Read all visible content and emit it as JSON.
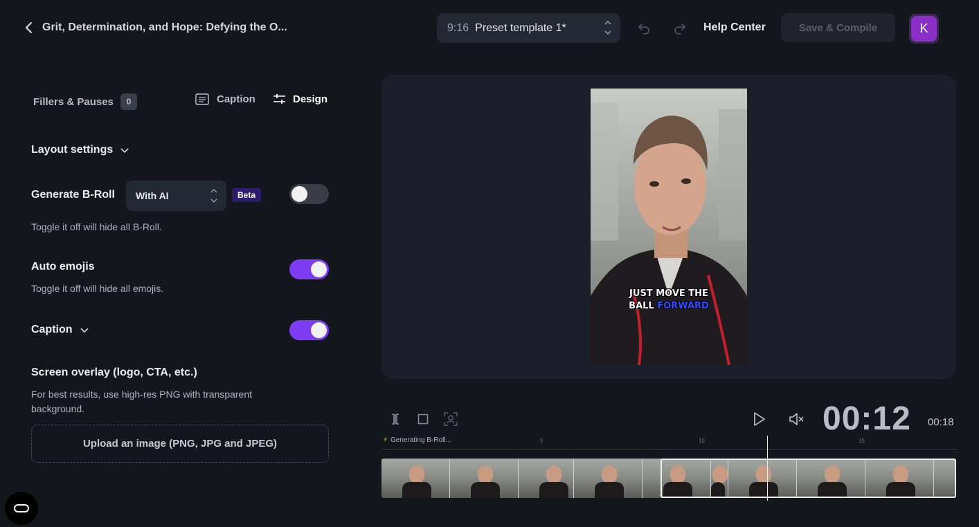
{
  "header": {
    "project_title": "Grit, Determination, and Hope: Defying the O...",
    "preset_ratio": "9:16",
    "preset_name": "Preset template 1*",
    "help_label": "Help Center",
    "save_label": "Save & Compile",
    "avatar_initial": "K"
  },
  "tabs": {
    "fillers_label": "Fillers & Pauses",
    "fillers_count": "0",
    "caption_label": "Caption",
    "design_label": "Design"
  },
  "settings": {
    "layout_label": "Layout settings",
    "broll_label": "Generate B-Roll",
    "broll_mode": "With AI",
    "beta_label": "Beta",
    "broll_desc": "Toggle it off will hide all B-Roll.",
    "broll_enabled": false,
    "emojis_label": "Auto emojis",
    "emojis_desc": "Toggle it off will hide all emojis.",
    "emojis_enabled": true,
    "caption_label": "Caption",
    "caption_enabled": true,
    "overlay_label": "Screen overlay (logo, CTA, etc.)",
    "overlay_desc": "For best results, use high-res PNG with transparent background.",
    "upload_label": "Upload an image (PNG, JPG and JPEG)"
  },
  "preview": {
    "caption_line1": "JUST MOVE THE",
    "caption_line2_plain": "BALL ",
    "caption_line2_highlight": "FORWARD",
    "highlight_color": "#2b4cff"
  },
  "player": {
    "timecode": "00:12",
    "duration": "00:18"
  },
  "timeline": {
    "status_label": "Generating B-Roll...",
    "ticks": [
      "5",
      "10",
      "15"
    ]
  },
  "colors": {
    "accent": "#7e3cf2",
    "avatar": "#8b2fc9",
    "background": "#14161d"
  }
}
